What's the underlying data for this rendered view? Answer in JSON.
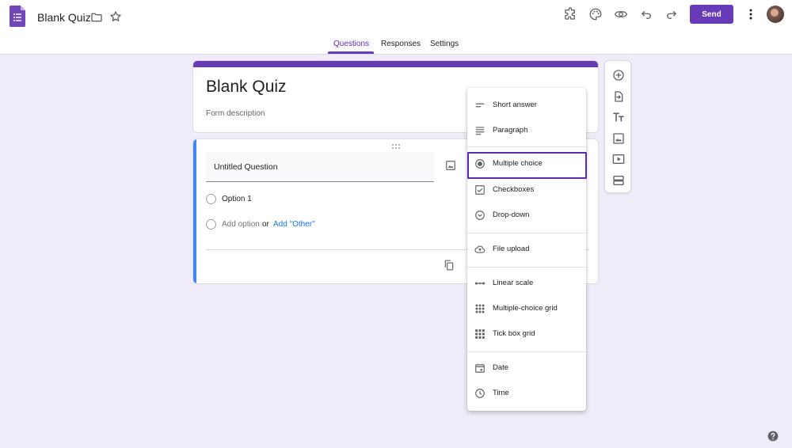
{
  "header": {
    "title": "Blank Quiz",
    "send_label": "Send",
    "icons": [
      "puzzle-icon",
      "palette-icon",
      "eye-icon",
      "undo-icon",
      "redo-icon"
    ],
    "accent": "#673ab7"
  },
  "tabs": [
    {
      "label": "Questions",
      "active": true
    },
    {
      "label": "Responses",
      "active": false
    },
    {
      "label": "Settings",
      "active": false
    }
  ],
  "form": {
    "title": "Blank Quiz",
    "description_placeholder": "Form description"
  },
  "question": {
    "title": "Untitled Question",
    "options": [
      "Option 1"
    ],
    "add_option": "Add option",
    "or": "or",
    "add_other": "Add \"Other\""
  },
  "toolbar": [
    "add-question-icon",
    "import-questions-icon",
    "add-title-icon",
    "add-image-icon",
    "add-video-icon",
    "add-section-icon"
  ],
  "question_types": {
    "selected": "Multiple choice",
    "groups": [
      [
        {
          "label": "Short answer",
          "icon": "short-answer-icon"
        },
        {
          "label": "Paragraph",
          "icon": "paragraph-icon"
        }
      ],
      [
        {
          "label": "Multiple choice",
          "icon": "radio-button-icon"
        },
        {
          "label": "Checkboxes",
          "icon": "checkbox-icon"
        },
        {
          "label": "Drop-down",
          "icon": "dropdown-icon"
        }
      ],
      [
        {
          "label": "File upload",
          "icon": "cloud-upload-icon"
        }
      ],
      [
        {
          "label": "Linear scale",
          "icon": "linear-scale-icon"
        },
        {
          "label": "Multiple-choice grid",
          "icon": "grid-dots-icon"
        },
        {
          "label": "Tick box grid",
          "icon": "grid-squares-icon"
        }
      ],
      [
        {
          "label": "Date",
          "icon": "calendar-icon"
        },
        {
          "label": "Time",
          "icon": "clock-icon"
        }
      ]
    ]
  }
}
